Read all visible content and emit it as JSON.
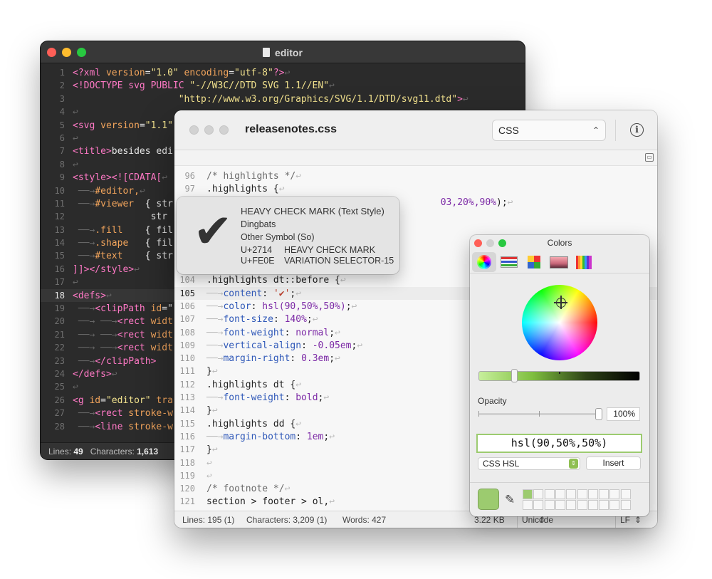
{
  "dark_window": {
    "title": "editor",
    "lines": [
      {
        "n": "1",
        "segs": [
          [
            "dk-tag",
            "<?xml "
          ],
          [
            "dk-attr",
            "version"
          ],
          [
            "dk-txt",
            "="
          ],
          [
            "dk-str",
            "\"1.0\""
          ],
          [
            "dk-attr",
            " encoding"
          ],
          [
            "dk-txt",
            "="
          ],
          [
            "dk-str",
            "\"utf-8\""
          ],
          [
            "dk-tag",
            "?>"
          ],
          [
            "dk-inv",
            "↩"
          ]
        ]
      },
      {
        "n": "2",
        "segs": [
          [
            "dk-tag",
            "<!DOCTYPE svg PUBLIC "
          ],
          [
            "dk-str",
            "\"-//W3C//DTD SVG 1.1//EN\""
          ],
          [
            "dk-inv",
            "↩"
          ]
        ]
      },
      {
        "n": "3",
        "segs": [
          [
            "dk-txt",
            "                   "
          ],
          [
            "dk-str",
            "\"http://www.w3.org/Graphics/SVG/1.1/DTD/svg11.dtd\""
          ],
          [
            "dk-tag",
            ">"
          ],
          [
            "dk-inv",
            "↩"
          ]
        ]
      },
      {
        "n": "4",
        "segs": [
          [
            "dk-inv",
            "↩"
          ]
        ]
      },
      {
        "n": "5",
        "segs": [
          [
            "dk-tag",
            "<svg "
          ],
          [
            "dk-attr",
            "version"
          ],
          [
            "dk-txt",
            "="
          ],
          [
            "dk-str",
            "\"1.1\""
          ]
        ]
      },
      {
        "n": "6",
        "segs": [
          [
            "dk-inv",
            "↩"
          ]
        ]
      },
      {
        "n": "7",
        "segs": [
          [
            "dk-tag",
            "<title>"
          ],
          [
            "dk-txt",
            "besides edi"
          ]
        ]
      },
      {
        "n": "8",
        "segs": [
          [
            "dk-inv",
            "↩"
          ]
        ]
      },
      {
        "n": "9",
        "segs": [
          [
            "dk-tag",
            "<style><![CDATA["
          ],
          [
            "dk-inv",
            "↩"
          ]
        ]
      },
      {
        "n": "10",
        "segs": [
          [
            "dk-inv",
            " ──→"
          ],
          [
            "dk-attr",
            "#editor,"
          ],
          [
            "dk-inv",
            "↩"
          ]
        ]
      },
      {
        "n": "11",
        "segs": [
          [
            "dk-inv",
            " ──→"
          ],
          [
            "dk-attr",
            "#viewer"
          ],
          [
            "dk-txt",
            "  { str"
          ]
        ]
      },
      {
        "n": "12",
        "segs": [
          [
            "dk-txt",
            "              str"
          ]
        ]
      },
      {
        "n": "13",
        "segs": [
          [
            "dk-inv",
            " ──→"
          ],
          [
            "dk-attr",
            ".fill"
          ],
          [
            "dk-txt",
            "    { fil"
          ]
        ]
      },
      {
        "n": "14",
        "segs": [
          [
            "dk-inv",
            " ──→"
          ],
          [
            "dk-attr",
            ".shape"
          ],
          [
            "dk-txt",
            "   { fil"
          ]
        ]
      },
      {
        "n": "15",
        "segs": [
          [
            "dk-inv",
            " ──→"
          ],
          [
            "dk-attr",
            "#text"
          ],
          [
            "dk-txt",
            "    { str"
          ]
        ]
      },
      {
        "n": "16",
        "segs": [
          [
            "dk-tag",
            "]]></style>"
          ],
          [
            "dk-inv",
            "↩"
          ]
        ]
      },
      {
        "n": "17",
        "segs": [
          [
            "dk-inv",
            "↩"
          ]
        ]
      },
      {
        "n": "18",
        "segs": [
          [
            "dk-tag",
            "<defs>"
          ],
          [
            "dk-inv",
            "↩"
          ]
        ],
        "current": true
      },
      {
        "n": "19",
        "segs": [
          [
            "dk-inv",
            " ──→"
          ],
          [
            "dk-tag",
            "<clipPath "
          ],
          [
            "dk-attr",
            "id"
          ],
          [
            "dk-txt",
            "=\""
          ]
        ]
      },
      {
        "n": "20",
        "segs": [
          [
            "dk-inv",
            " ──→ ──→"
          ],
          [
            "dk-tag",
            "<rect "
          ],
          [
            "dk-attr",
            "widt"
          ]
        ]
      },
      {
        "n": "21",
        "segs": [
          [
            "dk-inv",
            " ──→ ──→"
          ],
          [
            "dk-tag",
            "<rect "
          ],
          [
            "dk-attr",
            "widt"
          ]
        ]
      },
      {
        "n": "22",
        "segs": [
          [
            "dk-inv",
            " ──→ ──→"
          ],
          [
            "dk-tag",
            "<rect "
          ],
          [
            "dk-attr",
            "widt"
          ]
        ]
      },
      {
        "n": "23",
        "segs": [
          [
            "dk-inv",
            " ──→"
          ],
          [
            "dk-tag",
            "</clipPath>"
          ]
        ]
      },
      {
        "n": "24",
        "segs": [
          [
            "dk-tag",
            "</defs>"
          ],
          [
            "dk-inv",
            "↩"
          ]
        ]
      },
      {
        "n": "25",
        "segs": [
          [
            "dk-inv",
            "↩"
          ]
        ]
      },
      {
        "n": "26",
        "segs": [
          [
            "dk-tag",
            "<g "
          ],
          [
            "dk-attr",
            "id"
          ],
          [
            "dk-txt",
            "="
          ],
          [
            "dk-str",
            "\"editor\""
          ],
          [
            "dk-attr",
            " tra"
          ]
        ]
      },
      {
        "n": "27",
        "segs": [
          [
            "dk-inv",
            " ──→"
          ],
          [
            "dk-tag",
            "<rect "
          ],
          [
            "dk-attr",
            "stroke-w"
          ]
        ]
      },
      {
        "n": "28",
        "segs": [
          [
            "dk-inv",
            " ──→"
          ],
          [
            "dk-tag",
            "<line "
          ],
          [
            "dk-attr",
            "stroke-w"
          ]
        ]
      }
    ],
    "status": {
      "lines_label": "Lines:",
      "lines_value": "49",
      "chars_label": "Characters:",
      "chars_value": "1,613"
    }
  },
  "light_window": {
    "title": "releasenotes.css",
    "syntax": "CSS",
    "info_icon": "i",
    "lines": [
      {
        "n": "96",
        "segs": [
          [
            "lt-com",
            "/* highlights */"
          ],
          [
            "lt-inv",
            "↩"
          ]
        ]
      },
      {
        "n": "97",
        "segs": [
          [
            "lt-sel",
            ".highlights {"
          ],
          [
            "lt-inv",
            "↩"
          ]
        ]
      },
      {
        "n": "98",
        "segs": [
          [
            "lt-txt",
            "                                          "
          ],
          [
            "lt-num",
            "03,20%,90%"
          ],
          [
            "lt-sel",
            ");"
          ],
          [
            "lt-inv",
            "↩"
          ]
        ]
      },
      {
        "n": "99",
        "segs": []
      },
      {
        "n": "100",
        "segs": []
      },
      {
        "n": "101",
        "segs": []
      },
      {
        "n": "102",
        "segs": []
      },
      {
        "n": "103",
        "segs": []
      },
      {
        "n": "104",
        "segs": [
          [
            "lt-sel",
            ".highlights dt::before {"
          ],
          [
            "lt-inv",
            "↩"
          ]
        ]
      },
      {
        "n": "105",
        "segs": [
          [
            "lt-inv",
            "──→"
          ],
          [
            "lt-prop",
            "content"
          ],
          [
            "lt-sel",
            ": "
          ],
          [
            "lt-str",
            "'✔'"
          ],
          [
            "lt-sel",
            ";"
          ],
          [
            "lt-inv",
            "↩"
          ]
        ],
        "current": true
      },
      {
        "n": "106",
        "segs": [
          [
            "lt-inv",
            "──→"
          ],
          [
            "lt-prop",
            "color"
          ],
          [
            "lt-sel",
            ": "
          ],
          [
            "lt-val",
            "hsl(90,50%,50%)"
          ],
          [
            "lt-sel",
            ";"
          ],
          [
            "lt-inv",
            "↩"
          ]
        ]
      },
      {
        "n": "107",
        "segs": [
          [
            "lt-inv",
            "──→"
          ],
          [
            "lt-prop",
            "font-size"
          ],
          [
            "lt-sel",
            ": "
          ],
          [
            "lt-num",
            "140%"
          ],
          [
            "lt-sel",
            ";"
          ],
          [
            "lt-inv",
            "↩"
          ]
        ]
      },
      {
        "n": "108",
        "segs": [
          [
            "lt-inv",
            "──→"
          ],
          [
            "lt-prop",
            "font-weight"
          ],
          [
            "lt-sel",
            ": "
          ],
          [
            "lt-val",
            "normal"
          ],
          [
            "lt-sel",
            ";"
          ],
          [
            "lt-inv",
            "↩"
          ]
        ]
      },
      {
        "n": "109",
        "segs": [
          [
            "lt-inv",
            "──→"
          ],
          [
            "lt-prop",
            "vertical-align"
          ],
          [
            "lt-sel",
            ": "
          ],
          [
            "lt-num",
            "-0.05em"
          ],
          [
            "lt-sel",
            ";"
          ],
          [
            "lt-inv",
            "↩"
          ]
        ]
      },
      {
        "n": "110",
        "segs": [
          [
            "lt-inv",
            "──→"
          ],
          [
            "lt-prop",
            "margin-right"
          ],
          [
            "lt-sel",
            ": "
          ],
          [
            "lt-num",
            "0.3em"
          ],
          [
            "lt-sel",
            ";"
          ],
          [
            "lt-inv",
            "↩"
          ]
        ]
      },
      {
        "n": "111",
        "segs": [
          [
            "lt-sel",
            "}"
          ],
          [
            "lt-inv",
            "↩"
          ]
        ]
      },
      {
        "n": "112",
        "segs": [
          [
            "lt-sel",
            ".highlights dt {"
          ],
          [
            "lt-inv",
            "↩"
          ]
        ]
      },
      {
        "n": "113",
        "segs": [
          [
            "lt-inv",
            "──→"
          ],
          [
            "lt-prop",
            "font-weight"
          ],
          [
            "lt-sel",
            ": "
          ],
          [
            "lt-val",
            "bold"
          ],
          [
            "lt-sel",
            ";"
          ],
          [
            "lt-inv",
            "↩"
          ]
        ]
      },
      {
        "n": "114",
        "segs": [
          [
            "lt-sel",
            "}"
          ],
          [
            "lt-inv",
            "↩"
          ]
        ]
      },
      {
        "n": "115",
        "segs": [
          [
            "lt-sel",
            ".highlights dd {"
          ],
          [
            "lt-inv",
            "↩"
          ]
        ]
      },
      {
        "n": "116",
        "segs": [
          [
            "lt-inv",
            "──→"
          ],
          [
            "lt-prop",
            "margin-bottom"
          ],
          [
            "lt-sel",
            ": "
          ],
          [
            "lt-num",
            "1em"
          ],
          [
            "lt-sel",
            ";"
          ],
          [
            "lt-inv",
            "↩"
          ]
        ]
      },
      {
        "n": "117",
        "segs": [
          [
            "lt-sel",
            "}"
          ],
          [
            "lt-inv",
            "↩"
          ]
        ]
      },
      {
        "n": "118",
        "segs": [
          [
            "lt-inv",
            "↩"
          ]
        ]
      },
      {
        "n": "119",
        "segs": [
          [
            "lt-inv",
            "↩"
          ]
        ]
      },
      {
        "n": "120",
        "segs": [
          [
            "lt-com",
            "/* footnote */"
          ],
          [
            "lt-inv",
            "↩"
          ]
        ]
      },
      {
        "n": "121",
        "segs": [
          [
            "lt-sel",
            "section > footer > ol,"
          ],
          [
            "lt-inv",
            "↩"
          ]
        ]
      }
    ],
    "status": {
      "lines": "Lines: 195 (1)",
      "chars": "Characters: 3,209 (1)",
      "words": "Words: 427",
      "size": "3.22 KB",
      "encoding": "Unicode (UTF-8)",
      "line_ending": "LF"
    }
  },
  "char_popover": {
    "glyph": "✔",
    "name": "HEAVY CHECK MARK (Text Style)",
    "block": "Dingbats",
    "category": "Other Symbol (So)",
    "code1": "U+2714",
    "name1": "HEAVY CHECK MARK",
    "code2": "U+FE0E",
    "name2": "VARIATION SELECTOR-15"
  },
  "colors_panel": {
    "title": "Colors",
    "modes": [
      "color-wheel",
      "color-sliders",
      "color-palettes",
      "image-palettes",
      "pencils"
    ],
    "opacity_label": "Opacity",
    "opacity_value": "100%",
    "color_value": "hsl(90,50%,50%)",
    "format": "CSS HSL",
    "insert_label": "Insert",
    "current_color": "#9ccb6f"
  },
  "colors": {
    "close": "#ff5f57",
    "minimize": "#febc2e",
    "zoom": "#28c840"
  }
}
